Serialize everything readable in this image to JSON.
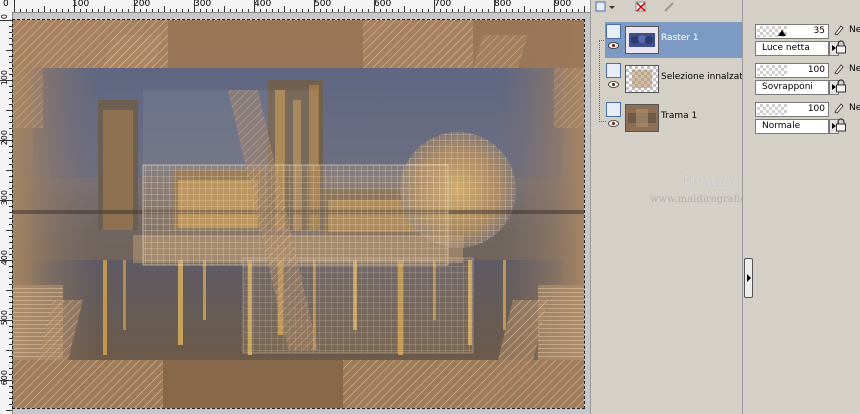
{
  "rulers": {
    "horizontal_labels": [
      "0",
      "100",
      "200",
      "300",
      "400",
      "500",
      "600",
      "700",
      "800",
      "900"
    ],
    "vertical_labels": [
      "0",
      "100",
      "200",
      "300",
      "400",
      "500",
      "600"
    ]
  },
  "watermark": {
    "name": "Pinuccia",
    "site": "www.maidiregrafica.eu"
  },
  "layers": [
    {
      "name": "Raster 1",
      "selected": true,
      "thumbnail": "blue-figures"
    },
    {
      "name": "Selezione innalzata",
      "selected": false,
      "thumbnail": "checkerboard"
    },
    {
      "name": "Trama 1",
      "selected": false,
      "thumbnail": "brown-texture"
    }
  ],
  "layer_properties": [
    {
      "opacity": "35",
      "blend_mode": "Luce netta",
      "ne": "Ne"
    },
    {
      "opacity": "100",
      "blend_mode": "Sovrapponi",
      "ne": "Ne"
    },
    {
      "opacity": "100",
      "blend_mode": "Normale",
      "ne": "Ne"
    }
  ],
  "icons": {
    "layer_visibility": "eye-icon",
    "layer_type": "raster-layer-icon",
    "edit": "pen-icon",
    "lock": "lock-icon",
    "collapse": "chevron-right-icon"
  },
  "colors": {
    "selected_layer": "#7d9ac4",
    "panel_bg": "#d4d0c8",
    "artwork_brown": "#8a6e52",
    "artwork_sky": "#5e6a8a",
    "city_lights": "#e8b04a"
  }
}
